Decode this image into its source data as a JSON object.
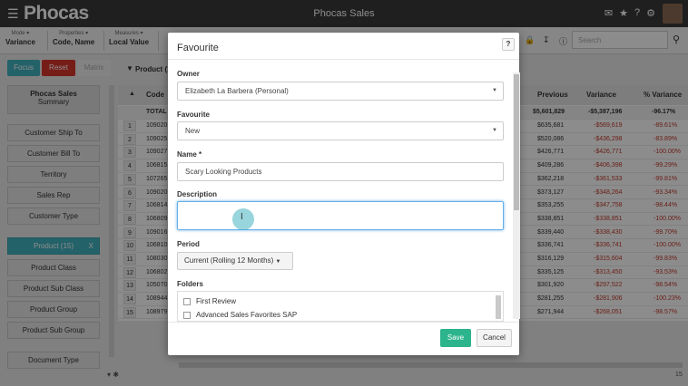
{
  "app": {
    "logo": "Phocas",
    "title": "Phocas Sales"
  },
  "topbar_icons": [
    "chat-icon",
    "star-icon",
    "help-icon",
    "settings-icon"
  ],
  "toolbar": {
    "groups": [
      {
        "small": "Mode",
        "value": "Variance"
      },
      {
        "small": "Properties",
        "value": "Code, Name"
      },
      {
        "small": "Measures",
        "value": "Local Value"
      }
    ],
    "search_placeholder": "Search"
  },
  "actions": {
    "focus": "Focus",
    "reset": "Reset",
    "matrix": "Matrix",
    "filter": "Product (1"
  },
  "sidebar": {
    "summary_title": "Phocas Sales",
    "summary_sub": "Summary",
    "items": [
      "Customer Ship To",
      "Customer Bill To",
      "Territory",
      "Sales Rep",
      "Customer Type"
    ],
    "active": "Product (15)",
    "active_close": "X",
    "items2": [
      "Product Class",
      "Product Sub Class",
      "Product Group",
      "Product Sub Group"
    ],
    "items3": [
      "Document Type"
    ]
  },
  "table": {
    "headers": {
      "code": "Code",
      "previous": "Previous",
      "variance": "Variance",
      "variance_pct": "% Variance"
    },
    "total": {
      "label": "TOTAL",
      "previous": "$5,601,829",
      "variance": "-$5,387,196",
      "pct": "-96.17%"
    },
    "rows": [
      {
        "n": "1",
        "code": "109020",
        "prev": "$635,681",
        "var": "-$569,619",
        "pct": "-89.61%"
      },
      {
        "n": "2",
        "code": "109025",
        "prev": "$520,086",
        "var": "-$436,298",
        "pct": "-83.89%"
      },
      {
        "n": "3",
        "code": "109027",
        "prev": "$426,771",
        "var": "-$426,771",
        "pct": "-100.00%"
      },
      {
        "n": "4",
        "code": "106815",
        "prev": "$409,286",
        "var": "-$406,398",
        "pct": "-99.29%"
      },
      {
        "n": "5",
        "code": "107265",
        "prev": "$362,218",
        "var": "-$361,533",
        "pct": "-99.81%"
      },
      {
        "n": "6",
        "code": "109020",
        "prev": "$373,127",
        "var": "-$348,264",
        "pct": "-93.34%"
      },
      {
        "n": "7",
        "code": "106814",
        "prev": "$353,255",
        "var": "-$347,758",
        "pct": "-98.44%"
      },
      {
        "n": "8",
        "code": "106809",
        "prev": "$338,851",
        "var": "-$338,851",
        "pct": "-100.00%"
      },
      {
        "n": "9",
        "code": "109016",
        "prev": "$339,440",
        "var": "-$338,430",
        "pct": "-99.70%"
      },
      {
        "n": "10",
        "code": "106810",
        "prev": "$336,741",
        "var": "-$336,741",
        "pct": "-100.00%"
      },
      {
        "n": "11",
        "code": "108030",
        "prev": "$316,129",
        "var": "-$315,604",
        "pct": "-99.83%"
      },
      {
        "n": "12",
        "code": "106802",
        "prev": "$335,125",
        "var": "-$313,450",
        "pct": "-93.53%"
      },
      {
        "n": "13",
        "code": "105070",
        "prev": "$301,920",
        "var": "-$297,522",
        "pct": "-98.54%"
      },
      {
        "n": "14",
        "code": "108944",
        "prev": "$281,255",
        "var": "-$281,906",
        "pct": "-100.23%"
      },
      {
        "n": "15",
        "code": "108979",
        "prev": "$271,944",
        "var": "-$268,051",
        "pct": "-98.57%"
      }
    ],
    "row_count": "15"
  },
  "modal": {
    "title": "Favourite",
    "owner_label": "Owner",
    "owner_value": "Elizabeth La Barbera (Personal)",
    "favourite_label": "Favourite",
    "favourite_value": "New",
    "name_label": "Name *",
    "name_value": "Scary Looking Products",
    "description_label": "Description",
    "period_label": "Period",
    "period_value": "Current (Rolling 12 Months)",
    "folders_label": "Folders",
    "folders": [
      "First Review",
      "Advanced Sales Favorites SAP"
    ],
    "save": "Save",
    "cancel": "Cancel"
  },
  "colors": {
    "focus": "#43b3c0",
    "reset": "#d9362b",
    "save": "#2cb48c",
    "negative": "#c0392b"
  }
}
